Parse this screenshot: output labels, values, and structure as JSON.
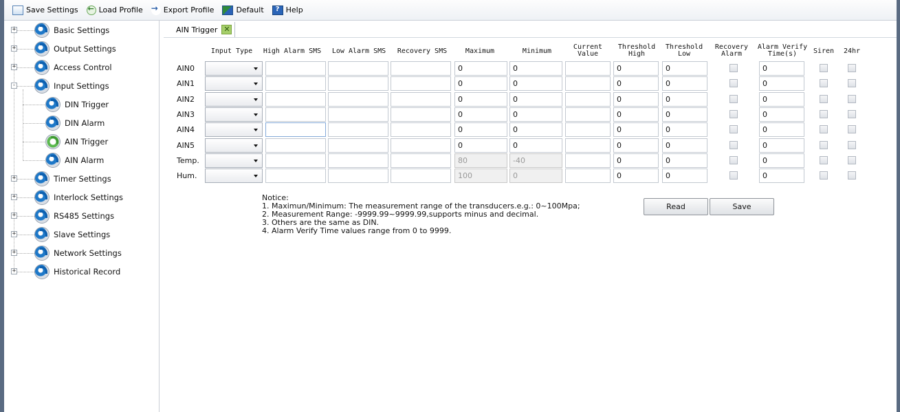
{
  "toolbar": {
    "save_settings": "Save Settings",
    "load_profile": "Load Profile",
    "export_profile": "Export Profile",
    "default": "Default",
    "help": "Help"
  },
  "tree": {
    "items": [
      {
        "label": "Basic Settings",
        "icon": "gear-icon",
        "level": 0,
        "expander": "+"
      },
      {
        "label": "Output Settings",
        "icon": "gear-icon",
        "level": 0,
        "expander": "+"
      },
      {
        "label": "Access Control",
        "icon": "gear-icon",
        "level": 0,
        "expander": "+"
      },
      {
        "label": "Input Settings",
        "icon": "gear-icon",
        "level": 0,
        "expander": "-"
      },
      {
        "label": "DIN Trigger",
        "icon": "gear-icon",
        "level": 1
      },
      {
        "label": "DIN Alarm",
        "icon": "gear-icon",
        "level": 1
      },
      {
        "label": "AIN Trigger",
        "icon": "gear-icon",
        "level": 1,
        "selected": true
      },
      {
        "label": "AIN Alarm",
        "icon": "gear-icon",
        "level": 1
      },
      {
        "label": "Timer Settings",
        "icon": "gear-icon",
        "level": 0,
        "expander": "+"
      },
      {
        "label": "Interlock Settings",
        "icon": "gear-icon",
        "level": 0,
        "expander": "+"
      },
      {
        "label": "RS485 Settings",
        "icon": "gear-icon",
        "level": 0,
        "expander": "+"
      },
      {
        "label": "Slave Settings",
        "icon": "gear-icon",
        "level": 0,
        "expander": "+"
      },
      {
        "label": "Network Settings",
        "icon": "gear-icon",
        "level": 0,
        "expander": "+"
      },
      {
        "label": "Historical Record",
        "icon": "gear-icon",
        "level": 0,
        "expander": "+"
      }
    ]
  },
  "tab": {
    "label": "AIN Trigger",
    "close_glyph": "✕"
  },
  "headers": {
    "input_type": "Input Type",
    "high_alarm_sms": "High Alarm SMS",
    "low_alarm_sms": "Low Alarm SMS",
    "recovery_sms": "Recovery SMS",
    "maximum": "Maximum",
    "minimum": "Minimum",
    "current_value_1": "Current",
    "current_value_2": "Value",
    "threshold_high_1": "Threshold",
    "threshold_high_2": "High",
    "threshold_low_1": "Threshold",
    "threshold_low_2": "Low",
    "recovery_alarm_1": "Recovery",
    "recovery_alarm_2": "Alarm",
    "alarm_verify_1": "Alarm Verify",
    "alarm_verify_2": "Time(s)",
    "siren": "Siren",
    "hr24": "24hr"
  },
  "rows": [
    {
      "label": "AIN0",
      "maximum": "0",
      "minimum": "0",
      "threshold_high": "0",
      "threshold_low": "0",
      "alarm_verify": "0",
      "disabled": false
    },
    {
      "label": "AIN1",
      "maximum": "0",
      "minimum": "0",
      "threshold_high": "0",
      "threshold_low": "0",
      "alarm_verify": "0",
      "disabled": false
    },
    {
      "label": "AIN2",
      "maximum": "0",
      "minimum": "0",
      "threshold_high": "0",
      "threshold_low": "0",
      "alarm_verify": "0",
      "disabled": false
    },
    {
      "label": "AIN3",
      "maximum": "0",
      "minimum": "0",
      "threshold_high": "0",
      "threshold_low": "0",
      "alarm_verify": "0",
      "disabled": false
    },
    {
      "label": "AIN4",
      "maximum": "0",
      "minimum": "0",
      "threshold_high": "0",
      "threshold_low": "0",
      "alarm_verify": "0",
      "disabled": false
    },
    {
      "label": "AIN5",
      "maximum": "0",
      "minimum": "0",
      "threshold_high": "0",
      "threshold_low": "0",
      "alarm_verify": "0",
      "disabled": false
    },
    {
      "label": "Temp.",
      "maximum": "80",
      "minimum": "-40",
      "threshold_high": "0",
      "threshold_low": "0",
      "alarm_verify": "0",
      "disabled": true
    },
    {
      "label": "Hum.",
      "maximum": "100",
      "minimum": "0",
      "threshold_high": "0",
      "threshold_low": "0",
      "alarm_verify": "0",
      "disabled": true
    }
  ],
  "notice": {
    "title": "Notice:",
    "lines": [
      "1. Maximun/Minimum: The measurement range of the transducers.e.g.: 0~100Mpa;",
      "2. Measurement Range: -9999.99~9999.99,supports minus and decimal.",
      "3. Others are the same as DIN.",
      "4. Alarm Verify Time values range from 0 to 9999."
    ]
  },
  "buttons": {
    "read": "Read",
    "save": "Save"
  }
}
